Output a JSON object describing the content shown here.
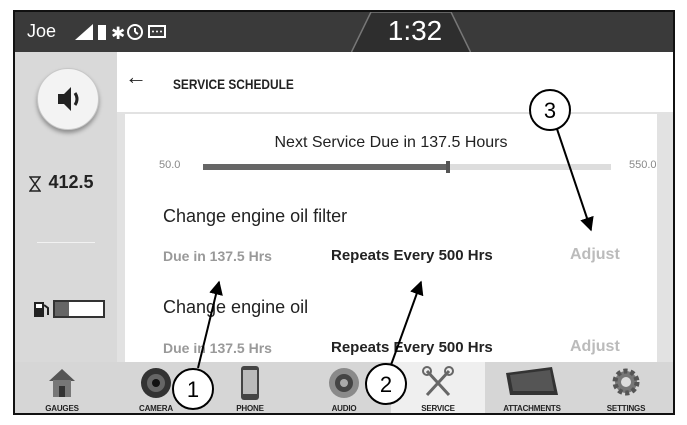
{
  "status": {
    "user": "Joe",
    "time": "1:32"
  },
  "left_panel": {
    "hours_value": "412.5",
    "fuel_level": 0.3,
    "icons": [
      "volume-icon",
      "hourglass-icon",
      "fuel-pump-icon"
    ]
  },
  "header": {
    "title": "SERVICE SCHEDULE"
  },
  "schedule": {
    "next_service": "Next Service Due in 137.5 Hours",
    "scale_min": "50.0",
    "scale_max": "550.0",
    "progress": 0.6,
    "items": [
      {
        "title": "Change engine oil filter",
        "due": "Due in 137.5 Hrs",
        "repeats": "Repeats Every 500 Hrs",
        "adjust": "Adjust"
      },
      {
        "title": "Change engine oil",
        "due": "Due in 137.5 Hrs",
        "repeats": "Repeats Every 500 Hrs",
        "adjust": "Adjust"
      }
    ]
  },
  "nav": {
    "items": [
      {
        "label": "GAUGES",
        "icon": "house-icon"
      },
      {
        "label": "CAMERA",
        "icon": "camera-icon"
      },
      {
        "label": "PHONE",
        "icon": "phone-icon"
      },
      {
        "label": "AUDIO",
        "icon": "speaker-icon"
      },
      {
        "label": "SERVICE",
        "icon": "wrench-icon"
      },
      {
        "label": "ATTACHMENTS",
        "icon": "bucket-icon"
      },
      {
        "label": "SETTINGS",
        "icon": "gear-icon"
      }
    ],
    "active": "SERVICE"
  },
  "callouts": [
    "1",
    "2",
    "3"
  ]
}
